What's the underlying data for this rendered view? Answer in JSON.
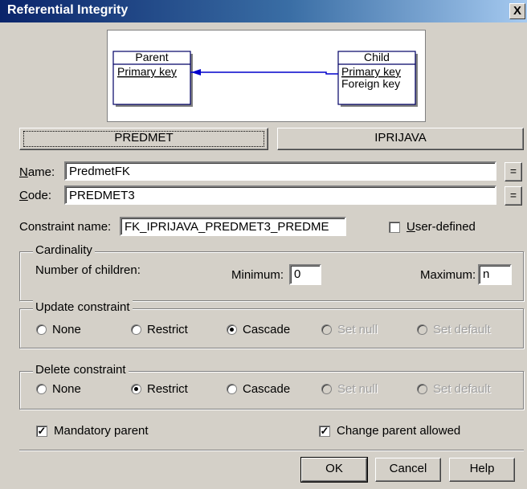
{
  "window": {
    "title": "Referential Integrity",
    "close_glyph": "X"
  },
  "diagram": {
    "parent": {
      "title": "Parent",
      "rows": [
        "Primary key"
      ]
    },
    "child": {
      "title": "Child",
      "rows": [
        "Primary key",
        "Foreign key"
      ]
    },
    "link_color": "#0000cc"
  },
  "tables": {
    "parent_button": "PREDMET",
    "child_button": "IPRIJAVA"
  },
  "name": {
    "label_u": "N",
    "label_rest": "ame:",
    "value": "PredmetFK",
    "eq": "="
  },
  "code": {
    "label_u": "C",
    "label_rest": "ode:",
    "value": "PREDMET3",
    "eq": "="
  },
  "constraint": {
    "label": "Constraint name:",
    "value": "FK_IPRIJAVA_PREDMET3_PREDME",
    "user_defined_u": "U",
    "user_defined_rest": "ser-defined"
  },
  "cardinality": {
    "legend": "Cardinality",
    "children_label": "Number of children:",
    "min_label": "Minimum:",
    "min_value": "0",
    "max_label": "Maximum:",
    "max_value": "n"
  },
  "update_constraint": {
    "legend": "Update constraint",
    "options": [
      "None",
      "Restrict",
      "Cascade",
      "Set null",
      "Set default"
    ],
    "selected": "Cascade"
  },
  "delete_constraint": {
    "legend": "Delete constraint",
    "options": [
      "None",
      "Restrict",
      "Cascade",
      "Set null",
      "Set default"
    ],
    "selected": "Restrict"
  },
  "mandatory_parent": {
    "label": "Mandatory parent",
    "checked": true
  },
  "change_parent": {
    "label": "Change parent allowed",
    "checked": true
  },
  "footer": {
    "ok": "OK",
    "cancel": "Cancel",
    "help": "Help"
  },
  "check_glyph": "✓"
}
